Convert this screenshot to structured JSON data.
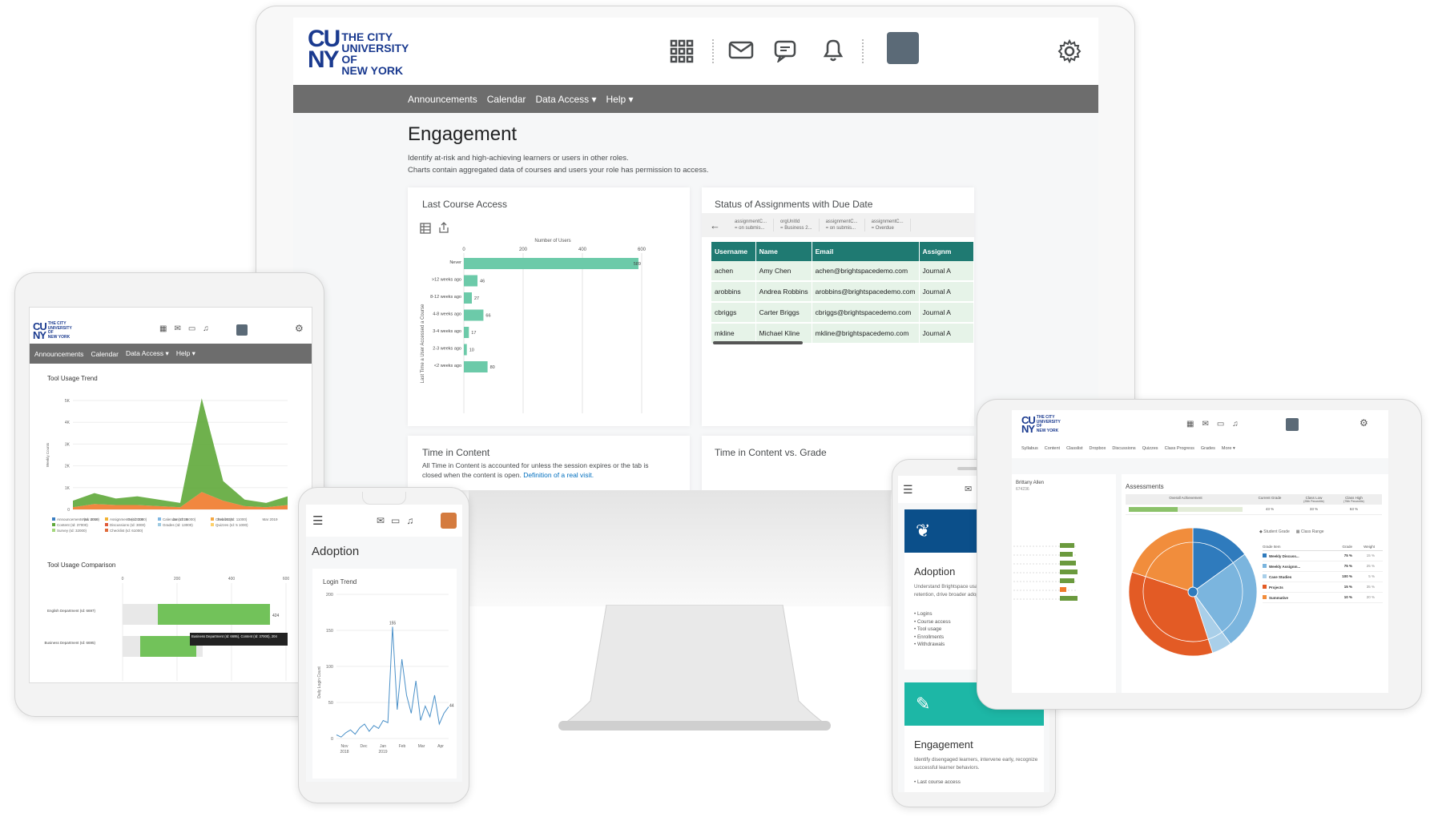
{
  "brand": {
    "line1": "THE CITY",
    "line2": "UNIVERSITY",
    "line3": "OF",
    "line4": "NEW YORK",
    "mark_top": "CU",
    "mark_bottom": "NY"
  },
  "colors": {
    "teal": "#1f7a72",
    "bar": "#6ccaa9",
    "nav": "#6d6d6d",
    "brand_blue": "#1a3a8f",
    "green": "#5fa83a",
    "orange": "#ef7a2b",
    "blue": "#4a90c8"
  },
  "nav": [
    "Announcements",
    "Calendar",
    "Data Access",
    "Help"
  ],
  "monitor": {
    "title": "Engagement",
    "desc1": "Identify at-risk and high-achieving learners or users in other roles.",
    "desc2": "Charts contain aggregated data of courses and users your role has permission to access.",
    "lca": {
      "title": "Last Course Access",
      "axis_top": "Number of Users",
      "ylabel": "Last Time a User Accessed a Course",
      "ticks": [
        "0",
        "200",
        "400",
        "600"
      ]
    },
    "status": {
      "title": "Status of Assignments with Due Date",
      "filters": [
        {
          "l1": "assignmentC...",
          "l2": "= on submis..."
        },
        {
          "l1": "orgUnitId",
          "l2": "= Business 2..."
        },
        {
          "l1": "assignmentC...",
          "l2": "= on submis..."
        },
        {
          "l1": "assignmentC...",
          "l2": "= Overdue"
        }
      ],
      "headers": [
        "Username",
        "Name",
        "Email",
        "Assignm"
      ],
      "rows": [
        [
          "achen",
          "Amy Chen",
          "achen@brightspacedemo.com",
          "Journal A"
        ],
        [
          "arobbins",
          "Andrea Robbins",
          "arobbins@brightspacedemo.com",
          "Journal A"
        ],
        [
          "cbriggs",
          "Carter Briggs",
          "cbriggs@brightspacedemo.com",
          "Journal A"
        ],
        [
          "mkline",
          "Michael Kline",
          "mkline@brightspacedemo.com",
          "Journal A"
        ]
      ]
    },
    "tic": {
      "title": "Time in Content",
      "desc": "All Time in Content is accounted for unless the session expires or the tab is closed when the content is open.",
      "link": "Definition of a real visit."
    },
    "ticg": {
      "title": "Time in Content vs. Grade"
    }
  },
  "tablet": {
    "trend_title": "Tool Usage Trend",
    "trend_ylabel": "Weekly Counts",
    "trend_yticks": [
      "5K",
      "4K",
      "3K",
      "2K",
      "1K",
      "0"
    ],
    "trend_months": [
      "Nov 2018",
      "Dec 2018",
      "Jan 2019",
      "Feb 2019",
      "Mar 2019"
    ],
    "trend_legend": [
      "Announcements (Id: 4000)",
      "Assignments (Id: 2000)",
      "Calendar (Id: 35000)",
      "Classlist (Id: 11000)",
      "Content (Id: 37000)",
      "Discussions (Id: 3000)",
      "Grades (Id: 13000)",
      "Quizzes (Id: 5 1000)",
      "Survey (Id: 32000)",
      "Checklist (Id: 61000)"
    ],
    "cmp_title": "Tool Usage Comparison",
    "cmp_ticks": [
      "0",
      "200",
      "400",
      "600"
    ],
    "cmp_rows": [
      "English Department (Id: 6697)",
      "Business Department (Id: 6695)"
    ],
    "cmp_value": "424",
    "tooltip": "Business Department (Id: 6695), Content (Id: 37000), 204"
  },
  "phone": {
    "title": "Adoption",
    "chart_title": "Login Trend",
    "ylabel": "Daily Login Count",
    "yticks": [
      "200",
      "150",
      "100",
      "50",
      "0"
    ],
    "xticks": [
      "Nov 2018",
      "Dec",
      "Jan 2019",
      "Feb",
      "Mar",
      "Apr"
    ],
    "peak": "155",
    "last": "44"
  },
  "phone2": {
    "cards": [
      {
        "title": "Adoption",
        "desc": "Understand Brightspace usage, evaluate course retention, drive broader adoption, inform ROI.",
        "items": [
          "Logins",
          "Course access",
          "Tool usage",
          "Enrollments",
          "Withdrawals"
        ]
      },
      {
        "title": "Engagement",
        "desc": "Identify disengaged learners, intervene early, recognize successful learner behaviors.",
        "items": [
          "Last course access"
        ]
      }
    ]
  },
  "tablet2": {
    "nav": [
      "Syllabus",
      "Content",
      "Classlist",
      "Dropbox",
      "Discussions",
      "Quizzes",
      "Class Progress",
      "Grades",
      "More"
    ],
    "student": "Brittany Allen",
    "student_id": "674236",
    "section": "Assessments",
    "table_headers": [
      "Overall Achievement",
      "Current Grade",
      "Class Low",
      "Class High"
    ],
    "table_sub": [
      "",
      "",
      "(25th Percentile)",
      "(75th Percentile)"
    ],
    "table_values": [
      "43 %",
      "33 %",
      "63 %"
    ],
    "legend": [
      "Student Grade",
      "Class Range"
    ],
    "grade_headers": [
      "Grade Item",
      "Grade",
      "Weight"
    ],
    "grades": [
      {
        "item": "Weekly Discuss...",
        "grade": "75 %",
        "weight": "15 %"
      },
      {
        "item": "Weekly Assignm...",
        "grade": "75 %",
        "weight": "25 %"
      },
      {
        "item": "Case Studies",
        "grade": "100 %",
        "weight": "5 %"
      },
      {
        "item": "Projects",
        "grade": "15 %",
        "weight": "35 %"
      },
      {
        "item": "Summative",
        "grade": "10 %",
        "weight": "20 %"
      }
    ]
  },
  "chart_data": [
    {
      "type": "bar",
      "title": "Last Course Access",
      "xlabel": "Number of Users",
      "ylabel": "Last Time a User Accessed a Course",
      "categories": [
        "Never",
        ">12 weeks ago",
        "8-12 weeks ago",
        "4-8 weeks ago",
        "3-4 weeks ago",
        "2-3 weeks ago",
        "<2 weeks ago"
      ],
      "values": [
        589,
        46,
        27,
        66,
        17,
        10,
        80
      ],
      "xlim": [
        0,
        600
      ]
    },
    {
      "type": "area",
      "title": "Tool Usage Trend",
      "ylabel": "Weekly Counts",
      "ylim": [
        0,
        5000
      ],
      "x": [
        "Nov 2018",
        "Dec 2018",
        "Jan 2019",
        "Feb 2019",
        "Mar 2019"
      ],
      "series": [
        {
          "name": "Content (Id: 37000)",
          "values": [
            300,
            500,
            300,
            400,
            300,
            200,
            4300,
            900,
            300,
            200,
            400
          ]
        },
        {
          "name": "Assignments (Id: 2000)",
          "values": [
            100,
            250,
            200,
            200,
            150,
            100,
            800,
            400,
            150,
            100,
            200
          ]
        }
      ]
    },
    {
      "type": "line",
      "title": "Login Trend",
      "ylabel": "Daily Login Count",
      "ylim": [
        0,
        200
      ],
      "x": [
        "Nov 2018",
        "Dec",
        "Jan 2019",
        "Feb",
        "Mar",
        "Apr"
      ],
      "series": [
        {
          "values": [
            5,
            2,
            8,
            12,
            6,
            15,
            20,
            10,
            18,
            14,
            25,
            22,
            155,
            40,
            110,
            60,
            35,
            80,
            25,
            45,
            30,
            60,
            20,
            35,
            44
          ]
        }
      ]
    }
  ]
}
